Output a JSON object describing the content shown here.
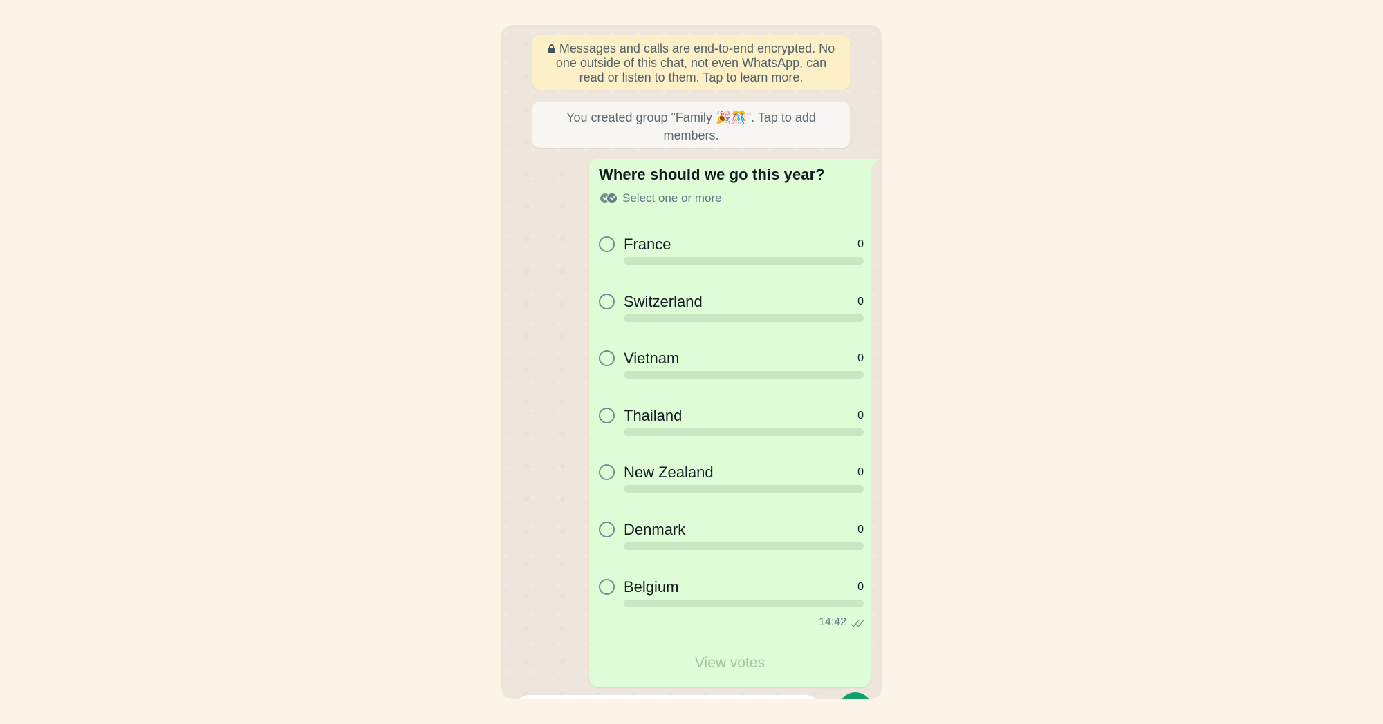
{
  "chat": {
    "encryption_notice": "Messages and calls are end-to-end encrypted. No one outside of this chat, not even WhatsApp, can read or listen to them. Tap to learn more.",
    "group_notice": "You created group \"Family 🎉🎊\". Tap to add members."
  },
  "poll": {
    "question": "Where should we go this year?",
    "subtitle": "Select one or more",
    "options": [
      {
        "label": "France",
        "votes": "0",
        "fraction": 0
      },
      {
        "label": "Switzerland",
        "votes": "0",
        "fraction": 0
      },
      {
        "label": "Vietnam",
        "votes": "0",
        "fraction": 0
      },
      {
        "label": "Thailand",
        "votes": "0",
        "fraction": 0
      },
      {
        "label": "New Zealand",
        "votes": "0",
        "fraction": 0
      },
      {
        "label": "Denmark",
        "votes": "0",
        "fraction": 0
      },
      {
        "label": "Belgium",
        "votes": "0",
        "fraction": 0
      }
    ],
    "timestamp": "14:42",
    "status_icon": "double-check-icon",
    "view_votes_label": "View votes"
  },
  "colors": {
    "bubble": "#defcd5",
    "encryption_bg": "#fdf0c7",
    "accent": "#11a06c"
  }
}
